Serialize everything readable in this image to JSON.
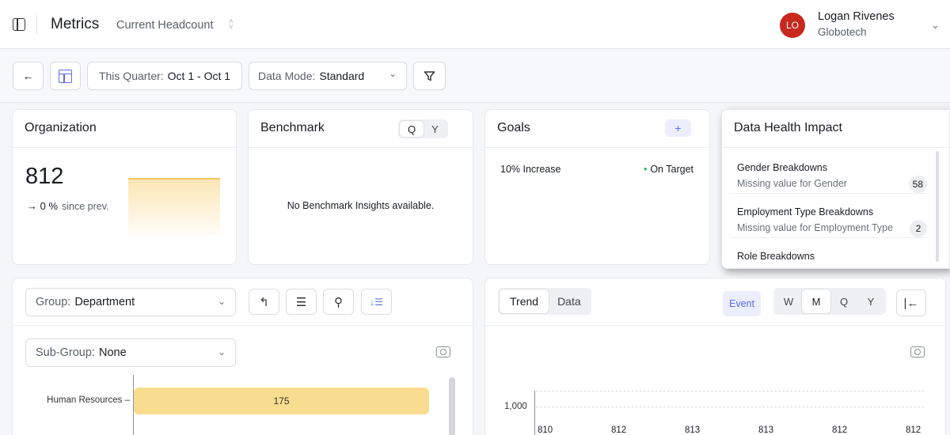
{
  "header": {
    "title": "Metrics",
    "subtitle": "Current Headcount",
    "user": {
      "initials": "LO",
      "name": "Logan Rivenes",
      "org": "Globotech"
    }
  },
  "toolbar": {
    "back_icon": "←",
    "period_label": "This Quarter:",
    "period_value": "Oct 1 - Oct 1",
    "mode_label": "Data Mode:",
    "mode_value": "Standard",
    "chevron": "⌄"
  },
  "organization": {
    "title": "Organization",
    "value": "812",
    "delta": "→ 0 %",
    "since": "since prev."
  },
  "benchmark": {
    "title": "Benchmark",
    "toggle": [
      "Q",
      "Y"
    ],
    "message": "No Benchmark Insights available."
  },
  "goals": {
    "title": "Goals",
    "add": "+",
    "goal_name": "10% Increase",
    "status": "On Target",
    "dot": "•"
  },
  "data_health": {
    "title": "Data Health Impact",
    "items": [
      {
        "title": "Gender Breakdowns",
        "sub": "Missing value for Gender",
        "count": "58"
      },
      {
        "title": "Employment Type Breakdowns",
        "sub": "Missing value for Employment Type",
        "count": "2"
      },
      {
        "title": "Role Breakdowns",
        "sub": "",
        "count": ""
      }
    ]
  },
  "breakdown": {
    "group_label": "Group:",
    "group_value": "Department",
    "subgroup_label": "Sub-Group:",
    "subgroup_value": "None",
    "icons": [
      "undo-icon",
      "list-icon",
      "search-person-icon",
      "sort-icon"
    ],
    "undo_glyph": "↰",
    "list_glyph": "☰",
    "search_glyph": "⚲",
    "sort_glyph": "↓☰",
    "bars": [
      {
        "label": "Human Resources",
        "value": 175
      }
    ],
    "bar_max": 180
  },
  "trend": {
    "tabs": [
      "Trend",
      "Data"
    ],
    "event": "Event",
    "periods": [
      "W",
      "M",
      "Q",
      "Y"
    ],
    "active_period": "M",
    "collapse_glyph": "|←",
    "y_tick": "1,000",
    "point_labels": [
      "810",
      "812",
      "813",
      "813",
      "812",
      "812"
    ]
  },
  "colors": {
    "accent": "#5b6ee8",
    "bar": "#f8dc8f",
    "avatar": "#c8281e",
    "on_target": "#1fb85b"
  }
}
